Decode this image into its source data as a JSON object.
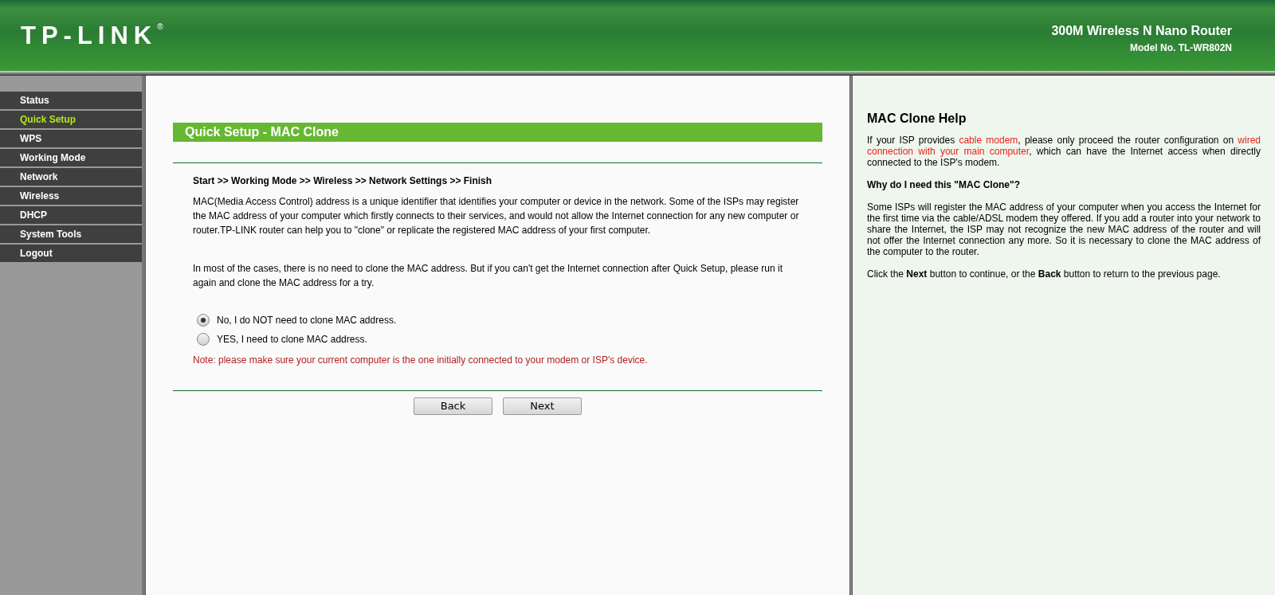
{
  "header": {
    "logo": "TP-LINK",
    "logo_mark": "®",
    "product": "300M Wireless N Nano Router",
    "model": "Model No. TL-WR802N"
  },
  "sidebar": {
    "items": [
      {
        "label": "Status",
        "selected": false
      },
      {
        "label": "Quick Setup",
        "selected": true
      },
      {
        "label": "WPS",
        "selected": false
      },
      {
        "label": "Working Mode",
        "selected": false
      },
      {
        "label": "Network",
        "selected": false
      },
      {
        "label": "Wireless",
        "selected": false
      },
      {
        "label": "DHCP",
        "selected": false
      },
      {
        "label": "System Tools",
        "selected": false
      },
      {
        "label": "Logout",
        "selected": false
      }
    ]
  },
  "main": {
    "title": "Quick Setup - MAC Clone",
    "breadcrumb": "Start >> Working Mode >> Wireless >> Network Settings >> Finish",
    "paragraphs": [
      "MAC(Media Access Control) address is a unique identifier that identifies your computer or device in the network. Some of the ISPs may register the MAC address of your computer which firstly connects to their services, and would not allow the Internet connection for any new computer or router.TP-LINK router can help you to \"clone\" or replicate the registered MAC address of your first computer.",
      "In most of the cases, there is no need to clone the MAC address. But if you can't get the Internet connection after Quick Setup, please run it again and clone the MAC address for a try."
    ],
    "options": [
      {
        "label": "No, I do NOT need to clone MAC address.",
        "selected": true
      },
      {
        "label": "YES, I need to clone MAC address.",
        "selected": false
      }
    ],
    "note": "Note: please make sure your current computer is the one initially connected to your modem or ISP's device.",
    "buttons": [
      "Back",
      "Next"
    ]
  },
  "help": {
    "title": "MAC Clone Help",
    "intro": [
      {
        "text": "If your ISP provides ",
        "highlight": false
      },
      {
        "text": "cable modem",
        "highlight": true
      },
      {
        "text": ", please only proceed the router configuration on ",
        "highlight": false
      },
      {
        "text": "wired connection with your main computer",
        "highlight": true
      },
      {
        "text": ", which can have the Internet access when directly connected to the ISP's modem.",
        "highlight": false
      }
    ],
    "question": "Why do I need this \"MAC Clone\"?",
    "answer": "Some ISPs will register the MAC address of your computer when you access the Internet for the first time via the cable/ADSL modem they offered. If you add a router into your network to share the Internet, the ISP may not recognize the new MAC address of the router and will not offer the Internet connection any more. So it is necessary to clone the MAC address of the computer to the router.",
    "footer": "Click the **Next** button to continue, or the **Back** button to return to the previous page."
  }
}
